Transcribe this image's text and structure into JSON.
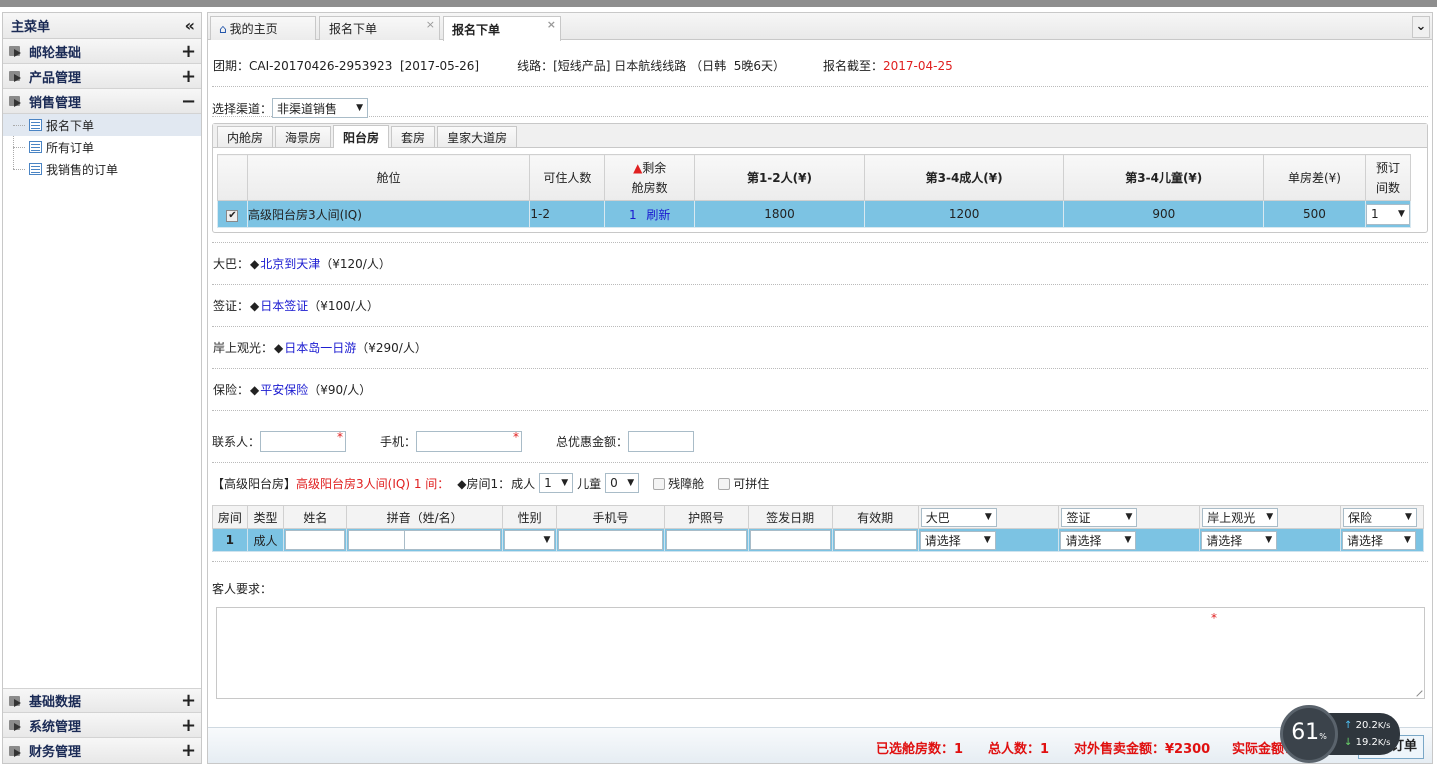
{
  "sidebar": {
    "title": "主菜单",
    "collapse_icon": "«",
    "groups_top": [
      {
        "label": "邮轮基础",
        "toggle": "+"
      },
      {
        "label": "产品管理",
        "toggle": "+"
      },
      {
        "label": "销售管理",
        "toggle": "−"
      }
    ],
    "sales_items": [
      {
        "label": "报名下单",
        "active": true
      },
      {
        "label": "所有订单"
      },
      {
        "label": "我销售的订单"
      }
    ],
    "groups_bottom": [
      {
        "label": "基础数据",
        "toggle": "+"
      },
      {
        "label": "系统管理",
        "toggle": "+"
      },
      {
        "label": "财务管理",
        "toggle": "+"
      }
    ]
  },
  "tabs": [
    {
      "label": "我的主页",
      "icon": "home-icon"
    },
    {
      "label": "报名下单",
      "close": "×"
    },
    {
      "label": "报名下单",
      "close": "×",
      "active": true
    }
  ],
  "tab_menu_icon": "≫",
  "group_info": {
    "group_label": "团期：",
    "group_code": "CAI-20170426-2953923",
    "group_date": "[2017-05-26]",
    "route_label": "线路：",
    "route_value": "[短线产品] 日本航线线路 （日韩  5晚6天）",
    "deadline_label": "报名截至：",
    "deadline_value": "2017-04-25"
  },
  "channel": {
    "label": "选择渠道：",
    "value": "非渠道销售"
  },
  "room_tabs": [
    "内舱房",
    "海景房",
    "阳台房",
    "套房",
    "皇家大道房"
  ],
  "room_tab_active": 2,
  "cabin_table": {
    "headers": {
      "cabin": "舱位",
      "capacity": "可住人数",
      "remaining_mark": "▲",
      "remaining_1": "剩余",
      "remaining_2": "舱房数",
      "price12": "第1-2人(¥)",
      "price34a": "第3-4成人(¥)",
      "price34c": "第3-4儿童(¥)",
      "single": "单房差(¥)",
      "rooms_1": "预订",
      "rooms_2": "间数"
    },
    "row": {
      "checked": "✔",
      "cabin": "高级阳台房3人间(IQ)",
      "capacity": "1-2",
      "remaining": "1",
      "refresh": "刷新",
      "price12": "1800",
      "price34a": "1200",
      "price34c": "900",
      "single": "500",
      "rooms": "1"
    }
  },
  "options": [
    {
      "label": "大巴：",
      "item": "北京到天津",
      "price": "（¥120/人）"
    },
    {
      "label": "签证：",
      "item": "日本签证",
      "price": "（¥100/人）"
    },
    {
      "label": "岸上观光：",
      "item": "日本岛一日游",
      "price": "（¥290/人）"
    },
    {
      "label": "保险：",
      "item": "平安保险",
      "price": "（¥90/人）"
    }
  ],
  "contact": {
    "name_label": "联系人：",
    "name_value": "",
    "phone_label": "手机：",
    "phone_value": "",
    "discount_label": "总优惠金额：",
    "discount_value": "",
    "required_mark": "*"
  },
  "room_line": {
    "category": "【高级阳台房】",
    "cabin_desc": "高级阳台房3人间(IQ) 1 间：",
    "room_label": "◆房间1：",
    "adult_label": "成人",
    "adult_value": "1",
    "child_label": "儿童",
    "child_value": "0",
    "disabled_label": "残障舱",
    "share_label": "可拼住"
  },
  "guest_table": {
    "headers": [
      "房间",
      "类型",
      "姓名",
      "拼音（姓/名）",
      "性别",
      "手机号",
      "护照号",
      "签发日期",
      "有效期"
    ],
    "option_headers": [
      "大巴",
      "签证",
      "岸上观光",
      "保险"
    ],
    "rows": [
      {
        "room": "1",
        "type": "成人",
        "name": "",
        "pinyin_last": "",
        "pinyin_first": "",
        "gender": "",
        "mobile": "",
        "passport": "",
        "issue_date": "",
        "expiry": "",
        "options": [
          "请选择",
          "请选择",
          "请选择",
          "请选择"
        ]
      }
    ]
  },
  "remarks": {
    "label": "客人要求：",
    "value": "",
    "required_mark": "*"
  },
  "footer": {
    "selected_rooms": "已选舱房数：1",
    "total_people": "总人数：1",
    "external_amount": "对外售卖金额：¥2300",
    "actual_amount": "实际金额：¥2300",
    "submit": "提交订单"
  },
  "net_widget": {
    "percent": "61",
    "percent_sign": "%",
    "up": "20.2",
    "down": "19.2",
    "unit": "K/s"
  }
}
